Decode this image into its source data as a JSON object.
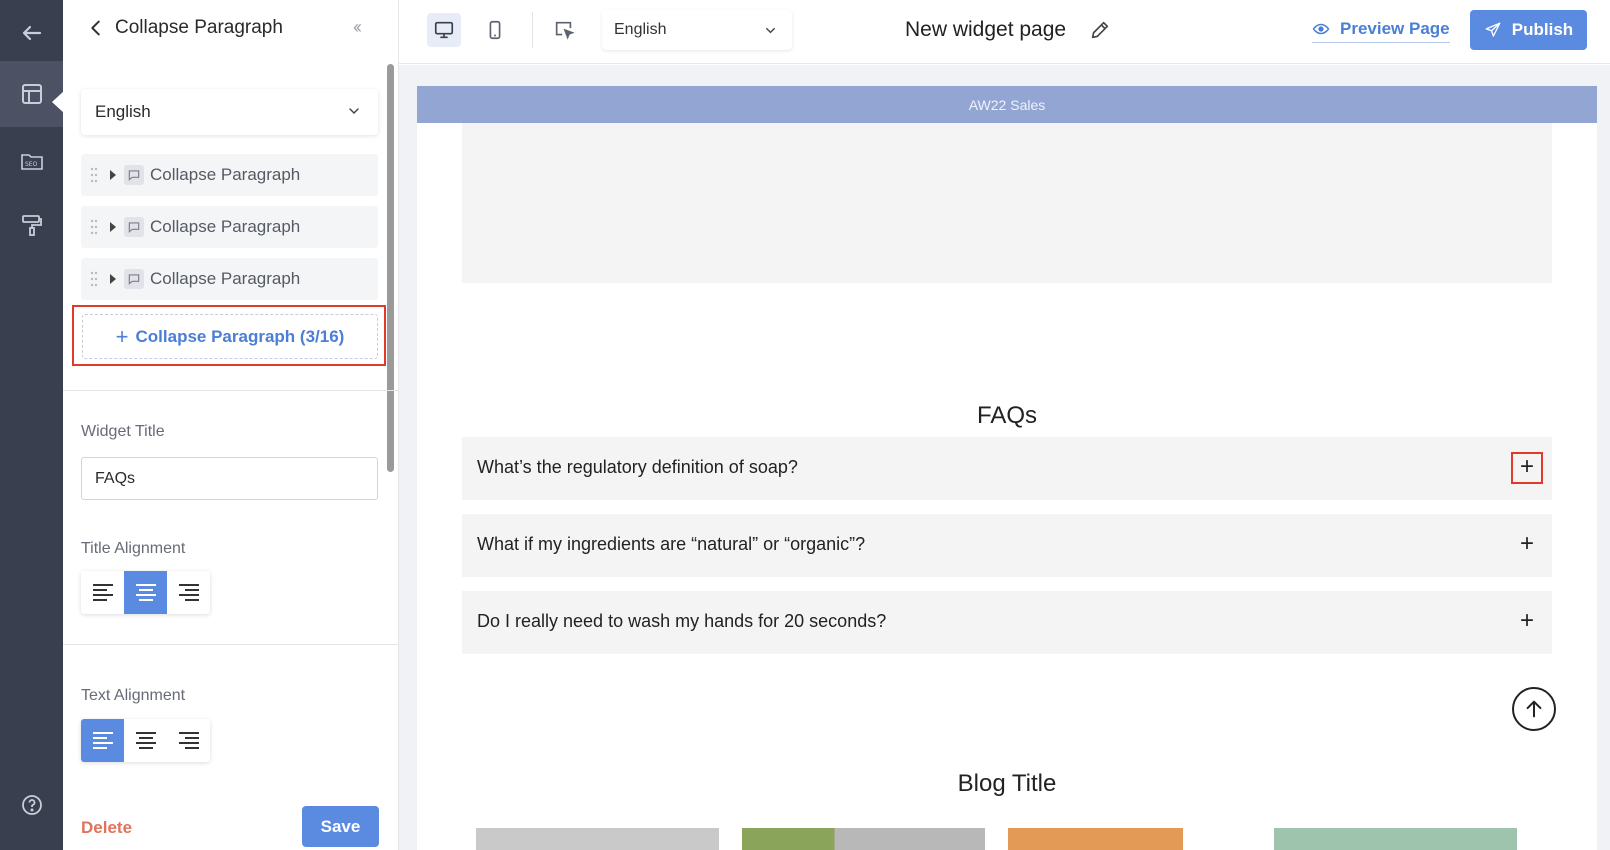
{
  "panel": {
    "title": "Collapse Paragraph",
    "language": "English",
    "items": [
      {
        "label": "Collapse Paragraph"
      },
      {
        "label": "Collapse Paragraph"
      },
      {
        "label": "Collapse Paragraph"
      }
    ],
    "add_label": "Collapse Paragraph (3/16)",
    "widget_title_label": "Widget Title",
    "widget_title_value": "FAQs",
    "title_alignment_label": "Title Alignment",
    "title_alignment_selected": "center",
    "text_alignment_label": "Text Alignment",
    "text_alignment_selected": "left",
    "delete_label": "Delete",
    "save_label": "Save"
  },
  "topbar": {
    "language": "English",
    "page_name": "New widget page",
    "preview_label": "Preview Page",
    "publish_label": "Publish"
  },
  "canvas": {
    "banner_text": "AW22 Sales",
    "faq_title": "FAQs",
    "faqs": [
      {
        "question": "What’s the regulatory definition of soap?"
      },
      {
        "question": "What if my ingredients are “natural” or “organic”?"
      },
      {
        "question": "Do I really need to wash my hands for 20 seconds?"
      }
    ],
    "blog_title": "Blog Title"
  },
  "colors": {
    "accent": "#5b8be0",
    "rail": "#3a3f4f",
    "banner": "#93a6d3",
    "highlight": "#e23a2a",
    "delete": "#e0735e"
  },
  "icons": [
    "arrow-left-icon",
    "layout-icon",
    "seo-icon",
    "paint-roller-icon",
    "help-icon",
    "chevron-left-icon",
    "double-chevron-left-icon",
    "chevron-down-icon",
    "drag-handle-icon",
    "comment-icon",
    "plus-icon",
    "align-left-icon",
    "align-center-icon",
    "align-right-icon",
    "desktop-icon",
    "mobile-icon",
    "cursor-select-icon",
    "pencil-icon",
    "eye-icon",
    "send-icon",
    "arrow-up-icon"
  ]
}
